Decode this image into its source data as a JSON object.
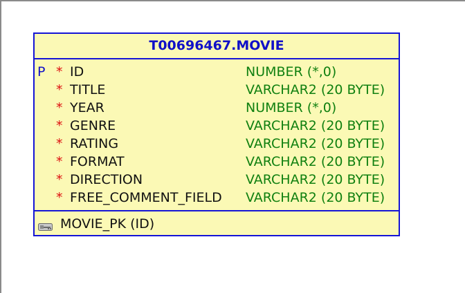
{
  "table": {
    "title": "T00696467.MOVIE",
    "columns": [
      {
        "pk": "P",
        "mandatory": "*",
        "name": "ID",
        "type": "NUMBER (*,0)"
      },
      {
        "pk": "",
        "mandatory": "*",
        "name": "TITLE",
        "type": "VARCHAR2 (20 BYTE)"
      },
      {
        "pk": "",
        "mandatory": "*",
        "name": "YEAR",
        "type": "NUMBER (*,0)"
      },
      {
        "pk": "",
        "mandatory": "*",
        "name": "GENRE",
        "type": "VARCHAR2 (20 BYTE)"
      },
      {
        "pk": "",
        "mandatory": "*",
        "name": "RATING",
        "type": "VARCHAR2 (20 BYTE)"
      },
      {
        "pk": "",
        "mandatory": "*",
        "name": "FORMAT",
        "type": "VARCHAR2 (20 BYTE)"
      },
      {
        "pk": "",
        "mandatory": "*",
        "name": "DIRECTION",
        "type": "VARCHAR2 (20 BYTE)"
      },
      {
        "pk": "",
        "mandatory": "*",
        "name": "FREE_COMMENT_FIELD",
        "type": "VARCHAR2 (20 BYTE)"
      }
    ],
    "indexes": [
      {
        "icon": "key-icon",
        "label": "MOVIE_PK (ID)"
      }
    ]
  },
  "colors": {
    "header_text": "#1010c8",
    "border": "#1414d6",
    "box_fill": "#fbf9b5",
    "mandatory_mark": "#dd1010",
    "type_text": "#108010"
  }
}
